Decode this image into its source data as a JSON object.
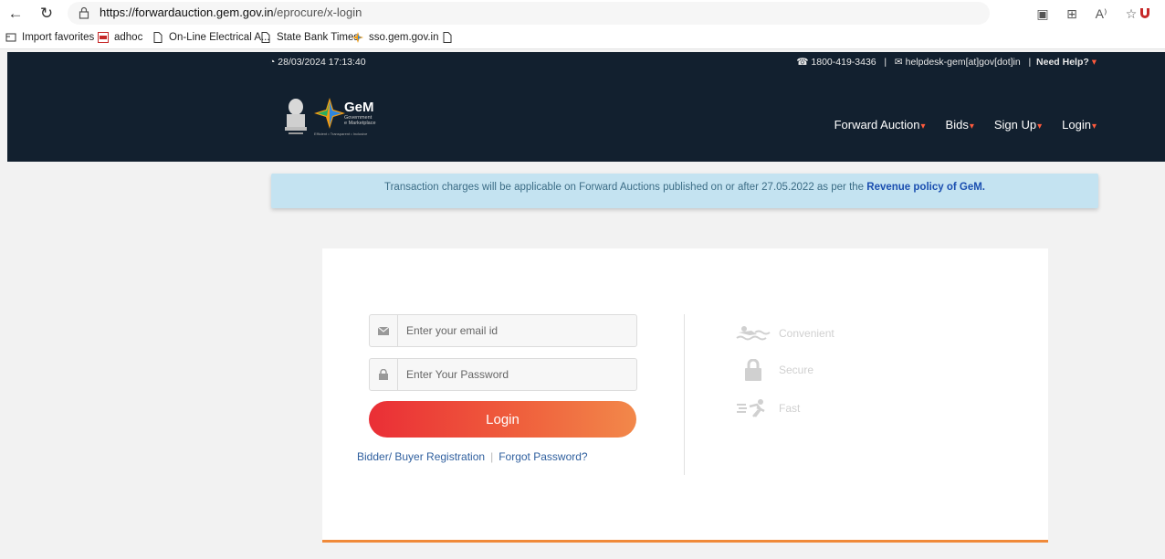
{
  "browser": {
    "url_host": "https://forwardauction.gem.gov.in",
    "url_path": "/eprocure/x-login",
    "icons": [
      "back-arrow-icon",
      "refresh-icon",
      "lock-icon",
      "reader-view-icon",
      "grid-icon",
      "read-aloud-icon",
      "favorite-star-icon",
      "extension-shield-icon"
    ]
  },
  "bookmarks": [
    {
      "label": "Import favorites",
      "icon": "import-icon"
    },
    {
      "label": "adhoc",
      "icon": "pdf-icon"
    },
    {
      "label": "On-Line Electrical A...",
      "icon": "page-icon"
    },
    {
      "label": "State Bank Times",
      "icon": "page-icon"
    },
    {
      "label": "sso.gem.gov.in",
      "icon": "gem-star-icon"
    },
    {
      "label": "",
      "icon": "page-icon"
    }
  ],
  "header": {
    "datetime": "28/03/2024 17:13:40",
    "phone": "1800-419-3436",
    "email": "helpdesk-gem[at]gov[dot]in",
    "help": "Need Help?",
    "logo": {
      "name": "GeM",
      "line1": "Government",
      "line2": "e Marketplace",
      "tagline": "Efficient • Transparent • Inclusive"
    },
    "nav": [
      "Forward Auction",
      "Bids",
      "Sign Up",
      "Login"
    ]
  },
  "notice": {
    "text": "Transaction charges will be applicable on Forward Auctions published on or after 27.05.2022 as per the ",
    "link": "Revenue policy of GeM."
  },
  "login": {
    "email_placeholder": "Enter your email id",
    "password_placeholder": "Enter Your Password",
    "button": "Login",
    "register_link": "Bidder/ Buyer Registration",
    "separator": "|",
    "forgot_link": "Forgot Password?"
  },
  "features": [
    {
      "label": "Convenient",
      "icon": "swimmer-icon"
    },
    {
      "label": "Secure",
      "icon": "padlock-icon"
    },
    {
      "label": "Fast",
      "icon": "runner-icon"
    }
  ],
  "colors": {
    "header_bg": "#12202f",
    "accent": "#ff5a3c",
    "button_start": "#ea2e36",
    "button_end": "#f2884a",
    "notice_bg": "#c4e3f1",
    "link": "#2f5f9e"
  }
}
